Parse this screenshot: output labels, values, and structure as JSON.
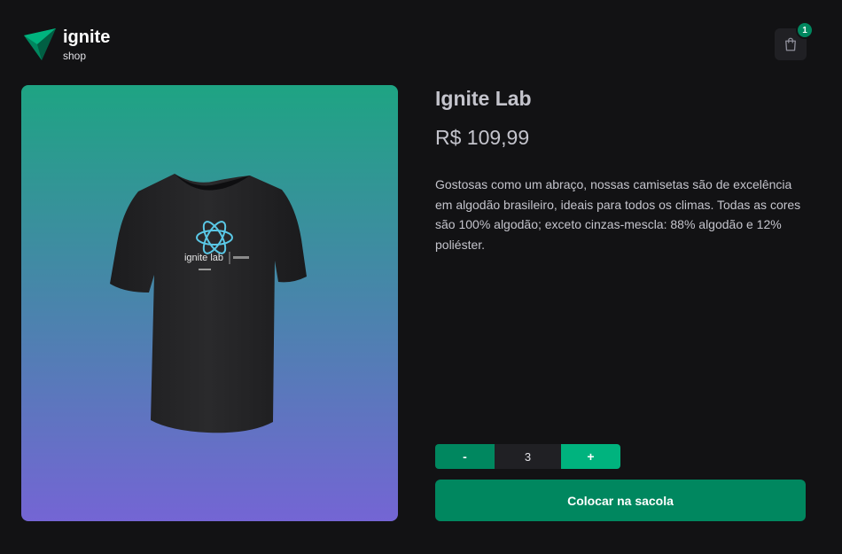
{
  "header": {
    "logo_title": "ignite",
    "logo_subtitle": "shop",
    "cart_count": "1",
    "cart_icon": "shopping-bag-icon"
  },
  "product": {
    "image_icon": "t-shirt-image",
    "shirt_print_text": "ignite lab",
    "title": "Ignite Lab",
    "price": "R$ 109,99",
    "description": "Gostosas como um abraço, nossas camisetas são de excelência em algodão brasileiro, ideais para todos os climas. Todas as cores são 100% algodão; exceto cinzas-mescla: 88% algodão e 12% poliéster."
  },
  "quantity": {
    "minus_label": "-",
    "value": "3",
    "plus_label": "+"
  },
  "actions": {
    "add_to_bag_label": "Colocar na sacola"
  },
  "colors": {
    "background": "#121214",
    "brand_green": "#00875f",
    "light_green": "#00b37e",
    "gradient_top": "#1ea483",
    "gradient_bottom": "#7465d4"
  }
}
